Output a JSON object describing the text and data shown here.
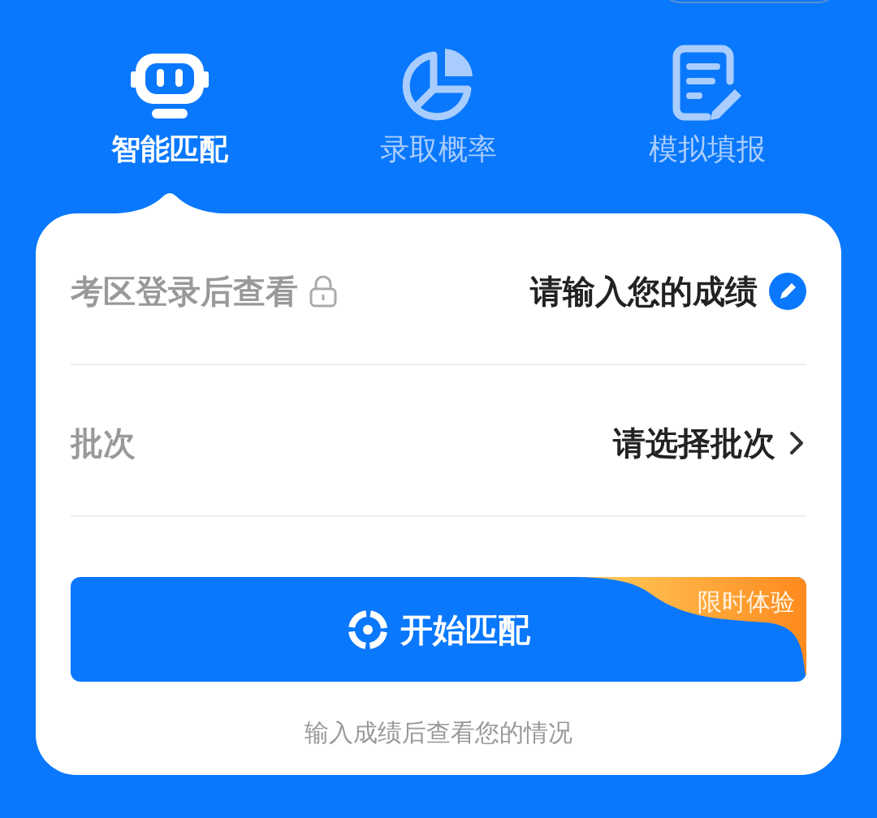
{
  "tabs": [
    {
      "label": "智能匹配",
      "kind": "robot",
      "selected": true
    },
    {
      "label": "录取概率",
      "kind": "pie",
      "selected": false
    },
    {
      "label": "模拟填报",
      "kind": "form",
      "selected": false
    }
  ],
  "form": {
    "rows": [
      {
        "label": "考区登录后查看",
        "locked": true,
        "value": "请输入您的成绩",
        "kind": "edit"
      },
      {
        "label": "批次",
        "locked": false,
        "value": "请选择批次",
        "kind": "chevron"
      }
    ],
    "button": {
      "label": "开始匹配",
      "badge": "限时体验"
    },
    "hint": "输入成绩后查看您的情况"
  }
}
